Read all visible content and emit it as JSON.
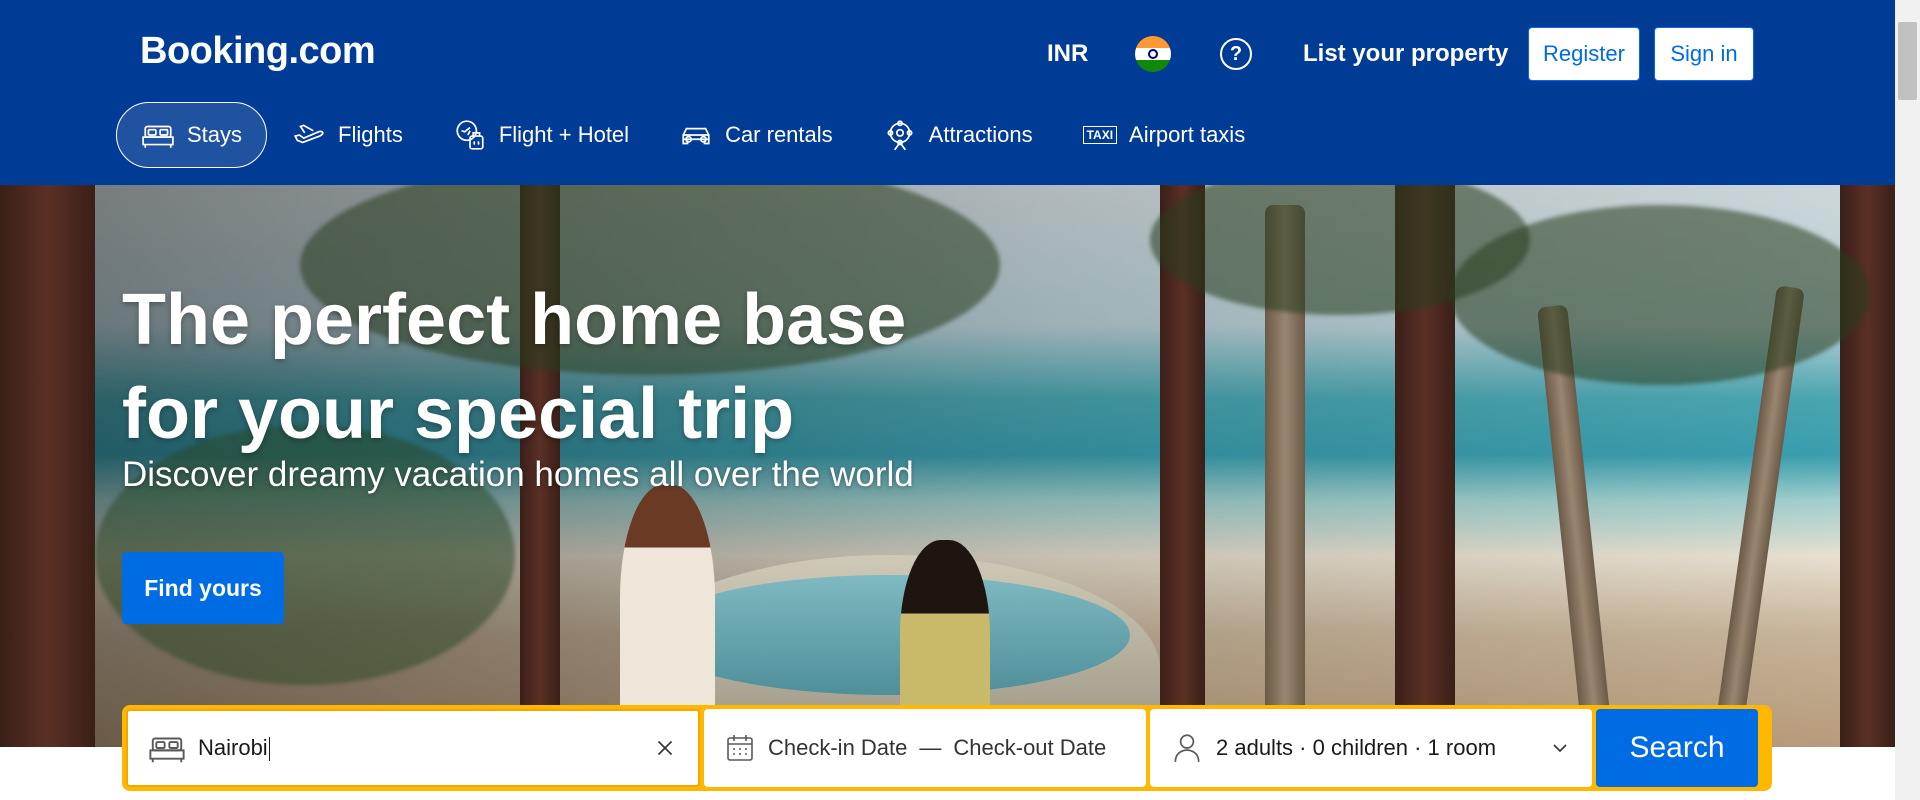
{
  "header": {
    "logo": "Booking.com",
    "currency": "INR",
    "help_label": "?",
    "list_property": "List your property",
    "register": "Register",
    "sign_in": "Sign in"
  },
  "nav": {
    "tabs": [
      {
        "label": "Stays",
        "icon": "bed-icon",
        "active": true
      },
      {
        "label": "Flights",
        "icon": "plane-icon",
        "active": false
      },
      {
        "label": "Flight + Hotel",
        "icon": "flight-hotel-icon",
        "active": false
      },
      {
        "label": "Car rentals",
        "icon": "car-icon",
        "active": false
      },
      {
        "label": "Attractions",
        "icon": "attractions-icon",
        "active": false
      },
      {
        "label": "Airport taxis",
        "icon": "taxi-icon",
        "taxi_badge": "TAXI",
        "active": false
      }
    ]
  },
  "hero": {
    "title_line1": "The perfect home base",
    "title_line2": "for your special trip",
    "subtitle": "Discover dreamy vacation homes all over the world",
    "cta": "Find yours"
  },
  "search": {
    "destination_value": "Nairobi",
    "check_in": "Check-in Date",
    "dash": "—",
    "check_out": "Check-out Date",
    "guests": "2 adults · 0 children · 1 room",
    "button": "Search"
  },
  "colors": {
    "brand_blue": "#003b95",
    "action_blue": "#006ce4",
    "search_border": "#ffb700"
  }
}
